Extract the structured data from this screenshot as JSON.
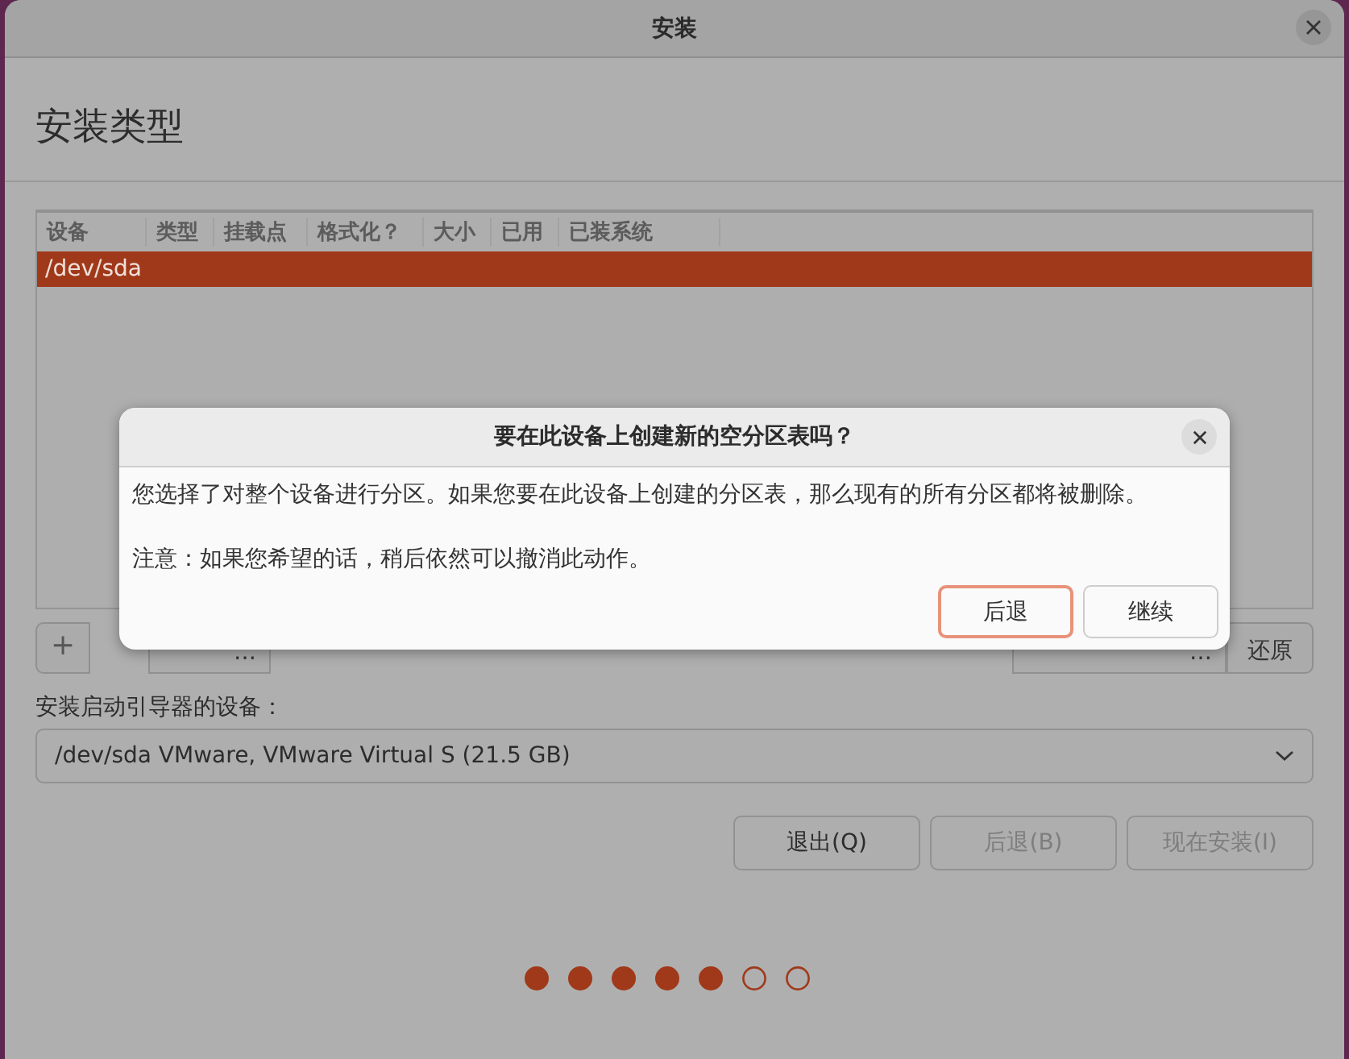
{
  "window": {
    "title": "安装"
  },
  "heading": "安装类型",
  "table": {
    "columns": [
      "设备",
      "类型",
      "挂载点",
      "格式化？",
      "大小",
      "已用",
      "已装系统"
    ],
    "rows": [
      {
        "device": "/dev/sda",
        "selected": true
      }
    ]
  },
  "partition_buttons": {
    "add": "+",
    "left": [
      "…"
    ],
    "right": [
      "…",
      "还原"
    ]
  },
  "bootloader": {
    "label": "安装启动引导器的设备：",
    "value": "/dev/sda VMware, VMware Virtual S (21.5 GB)"
  },
  "nav_buttons": [
    {
      "label": "退出(Q)",
      "disabled": false
    },
    {
      "label": "后退(B)",
      "disabled": true
    },
    {
      "label": "现在安装(I)",
      "disabled": true
    }
  ],
  "progress_steps": [
    {
      "done": true
    },
    {
      "done": true
    },
    {
      "done": true
    },
    {
      "done": true
    },
    {
      "done": true
    },
    {
      "done": false
    },
    {
      "done": false
    }
  ],
  "dialog": {
    "title": "要在此设备上创建新的空分区表吗？",
    "message": "您选择了对整个设备进行分区。如果您要在此设备上创建的分区表，那么现有的所有分区都将被删除。",
    "note": "注意：如果您希望的话，稍后依然可以撤消此动作。",
    "buttons": [
      {
        "label": "后退",
        "focused": true
      },
      {
        "label": "继续",
        "focused": false
      }
    ]
  }
}
